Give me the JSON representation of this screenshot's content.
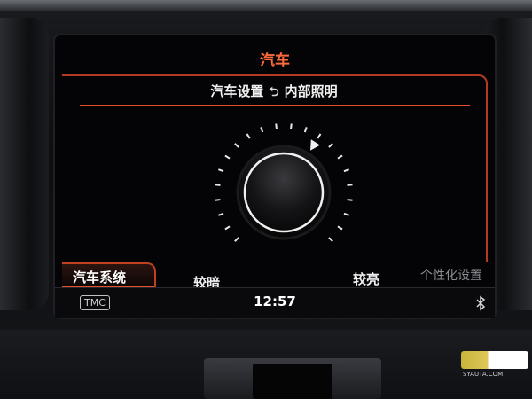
{
  "header": {
    "title": "汽车"
  },
  "breadcrumb": {
    "parent": "汽车设置",
    "current": "内部照明"
  },
  "dial": {
    "label_dark": "较暗",
    "label_bright": "较亮",
    "level": 0.62
  },
  "nav": {
    "active_tab": "汽车系统",
    "secondary": "个性化设置"
  },
  "status": {
    "tmc": "TMC",
    "time": "12:57"
  },
  "watermark": {
    "text": "SYAUTA.COM"
  },
  "colors": {
    "accent": "#e2502c",
    "title": "#ff6a3d"
  }
}
